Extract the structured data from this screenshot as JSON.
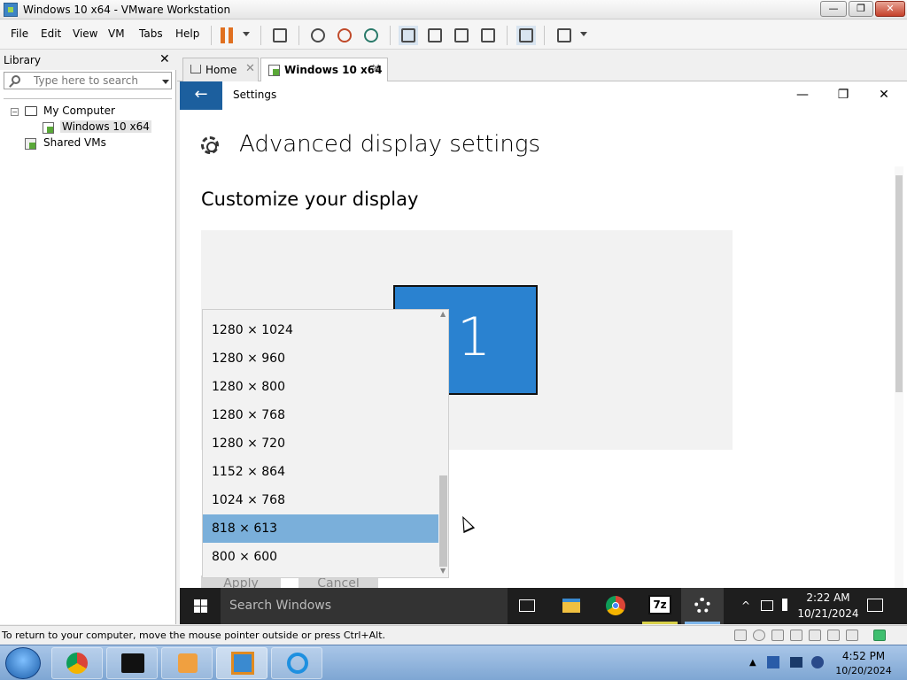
{
  "window": {
    "title": "Windows 10 x64 - VMware Workstation",
    "min": "—",
    "max": "❐",
    "close": "✕"
  },
  "menu": [
    "File",
    "Edit",
    "View",
    "VM",
    "Tabs",
    "Help"
  ],
  "library": {
    "title": "Library",
    "close": "✕",
    "search_placeholder": "Type here to search",
    "tree": {
      "my_computer": "My Computer",
      "vm": "Windows 10 x64",
      "shared": "Shared VMs",
      "expand": "−"
    }
  },
  "tabs": [
    {
      "label": "Home",
      "close": "✕"
    },
    {
      "label": "Windows 10 x64",
      "close": "✕"
    }
  ],
  "guest": {
    "app_title": "Settings",
    "back": "←",
    "win_min": "—",
    "win_max": "❐",
    "win_close": "✕",
    "heading": "Advanced display settings",
    "subheading": "Customize your display",
    "monitor_number": "1",
    "resolutions": [
      "1280 × 1024",
      "1280 × 960",
      "1280 × 800",
      "1280 × 768",
      "1280 × 720",
      "1152 × 864",
      "1024 × 768",
      "818 × 613",
      "800 × 600"
    ],
    "selected_resolution": "818 × 613",
    "apply": "Apply",
    "cancel": "Cancel",
    "taskbar": {
      "search": "Search Windows",
      "time": "2:22 AM",
      "date": "10/21/2024",
      "sevenzip": "7z"
    }
  },
  "status": {
    "text": "To return to your computer, move the mouse pointer outside or press Ctrl+Alt."
  },
  "host_taskbar": {
    "time": "4:52 PM",
    "date": "10/20/2024"
  },
  "colors": {
    "accent": "#1c5f9e",
    "monitor": "#2a82d0",
    "selected": "#7aafda",
    "pause": "#e07020"
  }
}
